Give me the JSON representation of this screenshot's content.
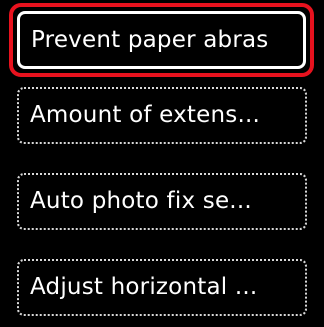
{
  "menu": {
    "items": [
      {
        "label": "Prevent paper abras",
        "selected": true
      },
      {
        "label": "Amount of extens...",
        "selected": false
      },
      {
        "label": "Auto photo fix se...",
        "selected": false
      },
      {
        "label": "Adjust horizontal ...",
        "selected": false
      }
    ]
  },
  "colors": {
    "background": "#000000",
    "text": "#ffffff",
    "selection_outline": "#e8121e",
    "item_border": "#d8d8d8"
  }
}
